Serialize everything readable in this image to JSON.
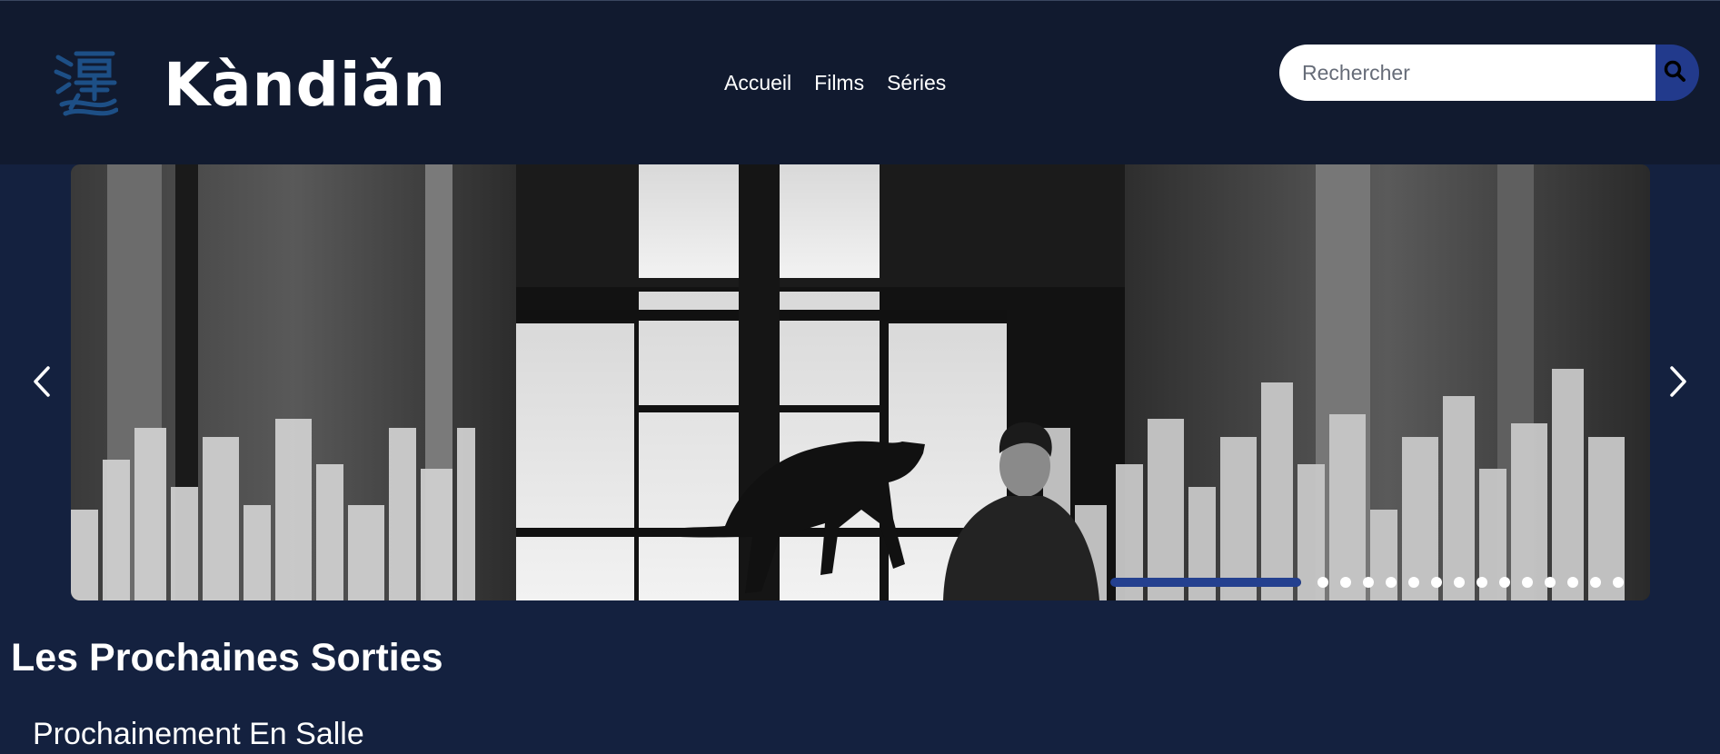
{
  "brand": {
    "name": "Kàndiǎn",
    "logo_icon": "kanji-logo-icon"
  },
  "nav": {
    "items": [
      {
        "label": "Accueil"
      },
      {
        "label": "Films"
      },
      {
        "label": "Séries"
      }
    ]
  },
  "search": {
    "placeholder": "Rechercher",
    "value": "",
    "icon": "search-icon"
  },
  "carousel": {
    "prev_icon": "chevron-left-icon",
    "next_icon": "chevron-right-icon",
    "slide_count": 14,
    "current_slide_progress": 1.0,
    "slide_image": "black-and-white film still: man and black panther in a hall with tall windows"
  },
  "sections": {
    "upcoming_title": "Les Prochaines Sorties",
    "in_theaters_title": "Prochainement En Salle"
  },
  "colors": {
    "header_bg": "#111a2f",
    "page_bg": "#14213f",
    "accent": "#223a8c",
    "logo_blue": "#1d4f86"
  }
}
